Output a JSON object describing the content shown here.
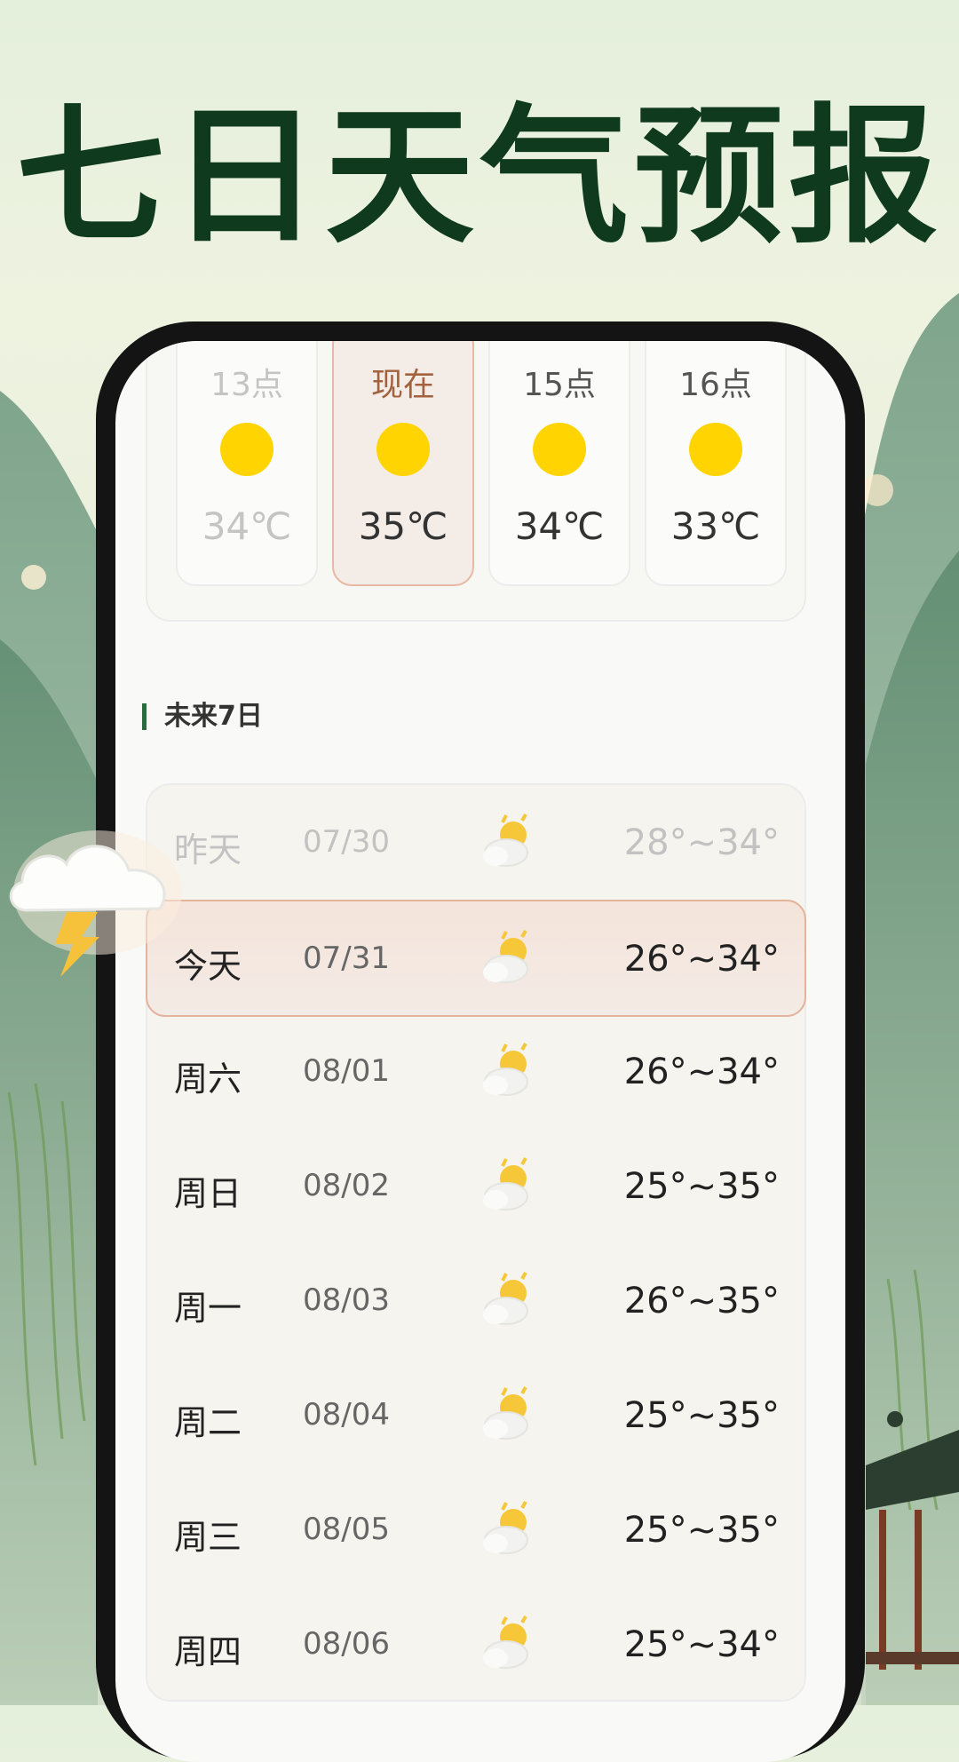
{
  "headline": "七日天气预报",
  "hourly": [
    {
      "label": "13点",
      "temp": "34℃",
      "faded": true,
      "now": false
    },
    {
      "label": "现在",
      "temp": "35℃",
      "faded": false,
      "now": true
    },
    {
      "label": "15点",
      "temp": "34℃",
      "faded": false,
      "now": false
    },
    {
      "label": "16点",
      "temp": "33℃",
      "faded": false,
      "now": false
    }
  ],
  "section_title": "未来7日",
  "days": [
    {
      "name": "昨天",
      "date": "07/30",
      "range": "28°~34°",
      "icon": "partly-sunny-icon",
      "state": "past"
    },
    {
      "name": "今天",
      "date": "07/31",
      "range": "26°~34°",
      "icon": "partly-sunny-icon",
      "state": "today"
    },
    {
      "name": "周六",
      "date": "08/01",
      "range": "26°~34°",
      "icon": "partly-sunny-icon",
      "state": ""
    },
    {
      "name": "周日",
      "date": "08/02",
      "range": "25°~35°",
      "icon": "partly-sunny-icon",
      "state": ""
    },
    {
      "name": "周一",
      "date": "08/03",
      "range": "26°~35°",
      "icon": "partly-sunny-icon",
      "state": ""
    },
    {
      "name": "周二",
      "date": "08/04",
      "range": "25°~35°",
      "icon": "partly-sunny-icon",
      "state": ""
    },
    {
      "name": "周三",
      "date": "08/05",
      "range": "25°~35°",
      "icon": "partly-sunny-icon",
      "state": ""
    },
    {
      "name": "周四",
      "date": "08/06",
      "range": "25°~34°",
      "icon": "partly-sunny-icon",
      "state": ""
    }
  ],
  "colors": {
    "headline": "#0f3a1e",
    "sun": "#ffd400",
    "accent_now": "#e3b39c"
  }
}
